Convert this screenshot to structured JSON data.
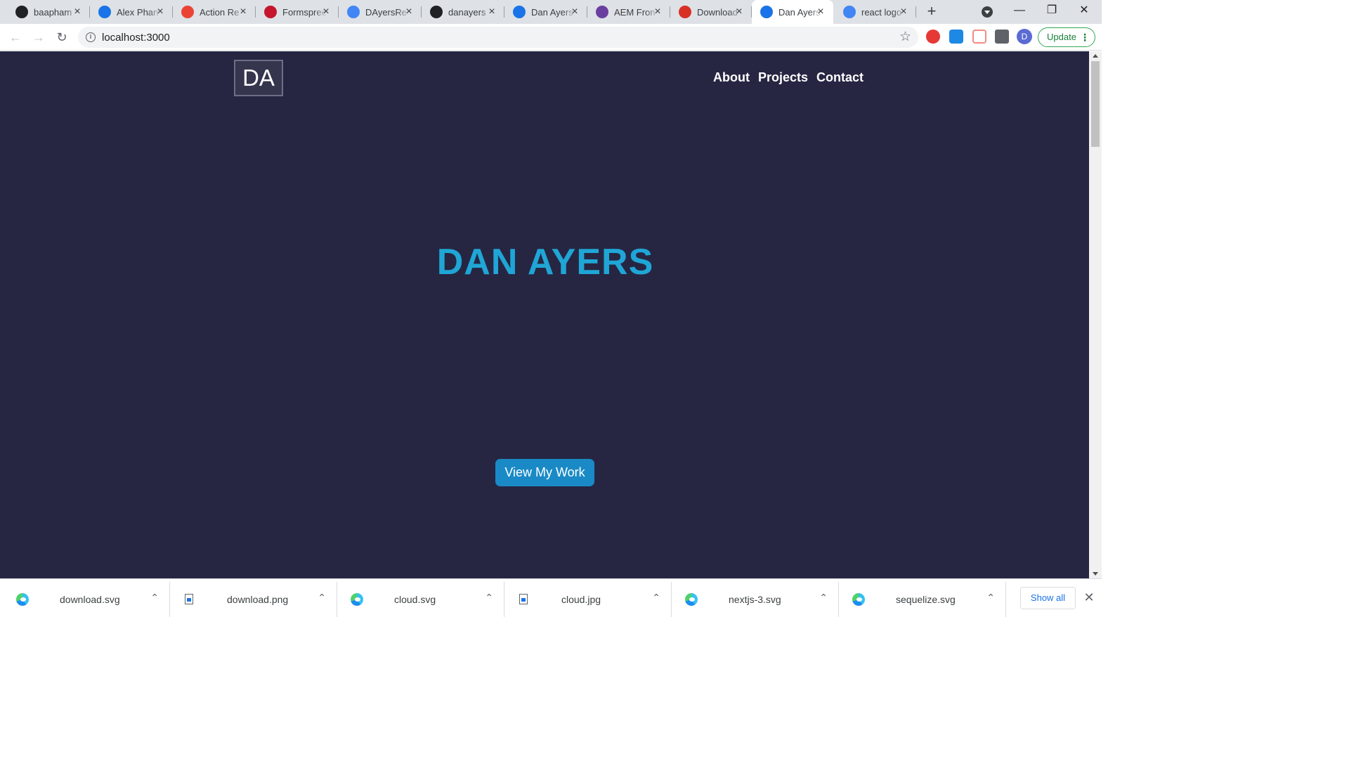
{
  "tabs": [
    {
      "title": "baapham",
      "favicon": "github-icon",
      "color": "#202124"
    },
    {
      "title": "Alex Phan",
      "favicon": "react-app-icon",
      "color": "#1a73e8"
    },
    {
      "title": "Action Re",
      "favicon": "gmail-icon",
      "color": "#ea4335"
    },
    {
      "title": "Formspree",
      "favicon": "formspree-icon",
      "color": "#c5162e"
    },
    {
      "title": "DAyersRe",
      "favicon": "google-docs-icon",
      "color": "#4285f4"
    },
    {
      "title": "danayers",
      "favicon": "github-icon",
      "color": "#202124"
    },
    {
      "title": "Dan Ayers",
      "favicon": "react-app-icon",
      "color": "#1a73e8"
    },
    {
      "title": "AEM Fron",
      "favicon": "star-icon",
      "color": "#6b3fa0"
    },
    {
      "title": "Download",
      "favicon": "download-site-icon",
      "color": "#d93025"
    },
    {
      "title": "Dan Ayers",
      "favicon": "react-app-icon",
      "color": "#1a73e8",
      "active": true
    },
    {
      "title": "react logo",
      "favicon": "google-icon",
      "color": "#4285f4"
    }
  ],
  "toolbar": {
    "url": "localhost:3000",
    "update_label": "Update",
    "avatar_letter": "D"
  },
  "page": {
    "logo": "DA",
    "nav": [
      "About",
      "Projects",
      "Contact"
    ],
    "hero_title": "DAN AYERS",
    "cta_label": "View My Work",
    "colors": {
      "background": "#262643",
      "title": "#1fa6d6",
      "button": "#1a8ac6"
    }
  },
  "downloads": [
    {
      "name": "download.svg",
      "icon": "edge-icon"
    },
    {
      "name": "download.png",
      "icon": "file-icon"
    },
    {
      "name": "cloud.svg",
      "icon": "edge-icon"
    },
    {
      "name": "cloud.jpg",
      "icon": "file-icon"
    },
    {
      "name": "nextjs-3.svg",
      "icon": "edge-icon"
    },
    {
      "name": "sequelize.svg",
      "icon": "edge-icon"
    }
  ],
  "shelf": {
    "show_all_label": "Show all"
  }
}
